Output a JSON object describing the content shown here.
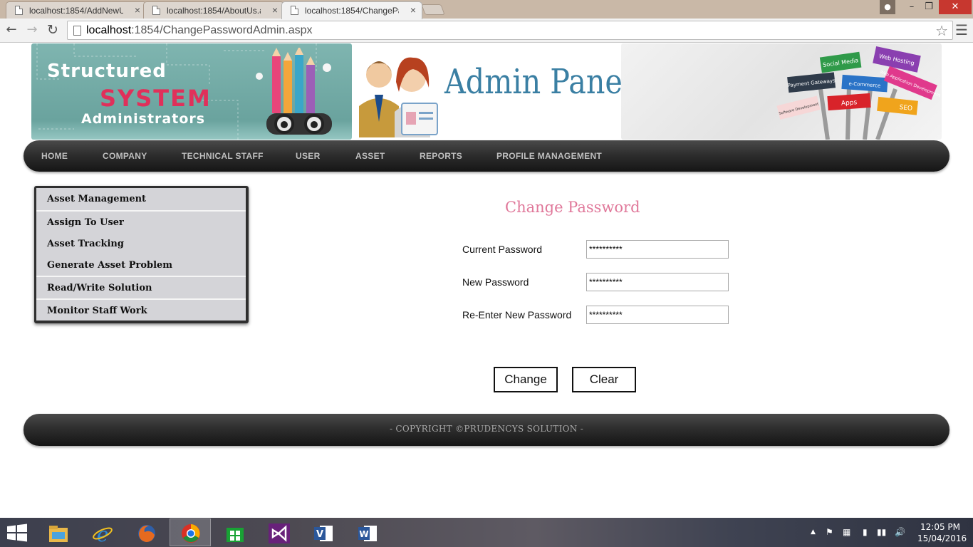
{
  "browser": {
    "tabs": [
      {
        "label": "localhost:1854/AddNewU"
      },
      {
        "label": "localhost:1854/AboutUs.a"
      },
      {
        "label": "localhost:1854/ChangePa"
      }
    ],
    "close_glyph": "×",
    "url_host": "localhost",
    "url_path": ":1854/ChangePasswordAdmin.aspx"
  },
  "banner": {
    "brand_line1": "Structured",
    "brand_line2": "SYSTEM",
    "brand_line3": "Administrators",
    "admin_title": "Admin Panel",
    "signs": [
      "Social Media",
      "Web Hosting",
      "Payment Gateways",
      "e-Commerce",
      "Web Application Development",
      "Apps",
      "SEO",
      "Software Development"
    ]
  },
  "topnav": [
    "HOME",
    "COMPANY",
    "TECHNICAL STAFF",
    "USER",
    "ASSET",
    "REPORTS",
    "PROFILE MANAGEMENT"
  ],
  "sidemenu": [
    "Asset Management",
    "Assign To User",
    "Asset Tracking",
    "Generate Asset Problem",
    "Read/Write Solution",
    "Monitor Staff Work"
  ],
  "form": {
    "title": "Change Password",
    "fields": [
      {
        "label": "Current Password",
        "value": "**********"
      },
      {
        "label": "New Password",
        "value": "**********"
      },
      {
        "label": "Re-Enter New Password",
        "value": "**********"
      }
    ],
    "change_label": "Change",
    "clear_label": "Clear"
  },
  "footer": {
    "text": "- COPYRIGHT ©PRUDENCYS SOLUTION -"
  },
  "taskbar": {
    "apps": [
      "file-explorer-icon",
      "internet-explorer-icon",
      "firefox-icon",
      "chrome-icon",
      "store-icon",
      "visual-studio-icon",
      "visio-icon",
      "word-icon"
    ],
    "time": "12:05 PM",
    "date": "15/04/2016"
  },
  "colors": {
    "accent_title": "#e0789a",
    "nav_dark": "#1f1f1f",
    "brand_red": "#e0305a",
    "admin_blue": "#3a7fa3"
  }
}
